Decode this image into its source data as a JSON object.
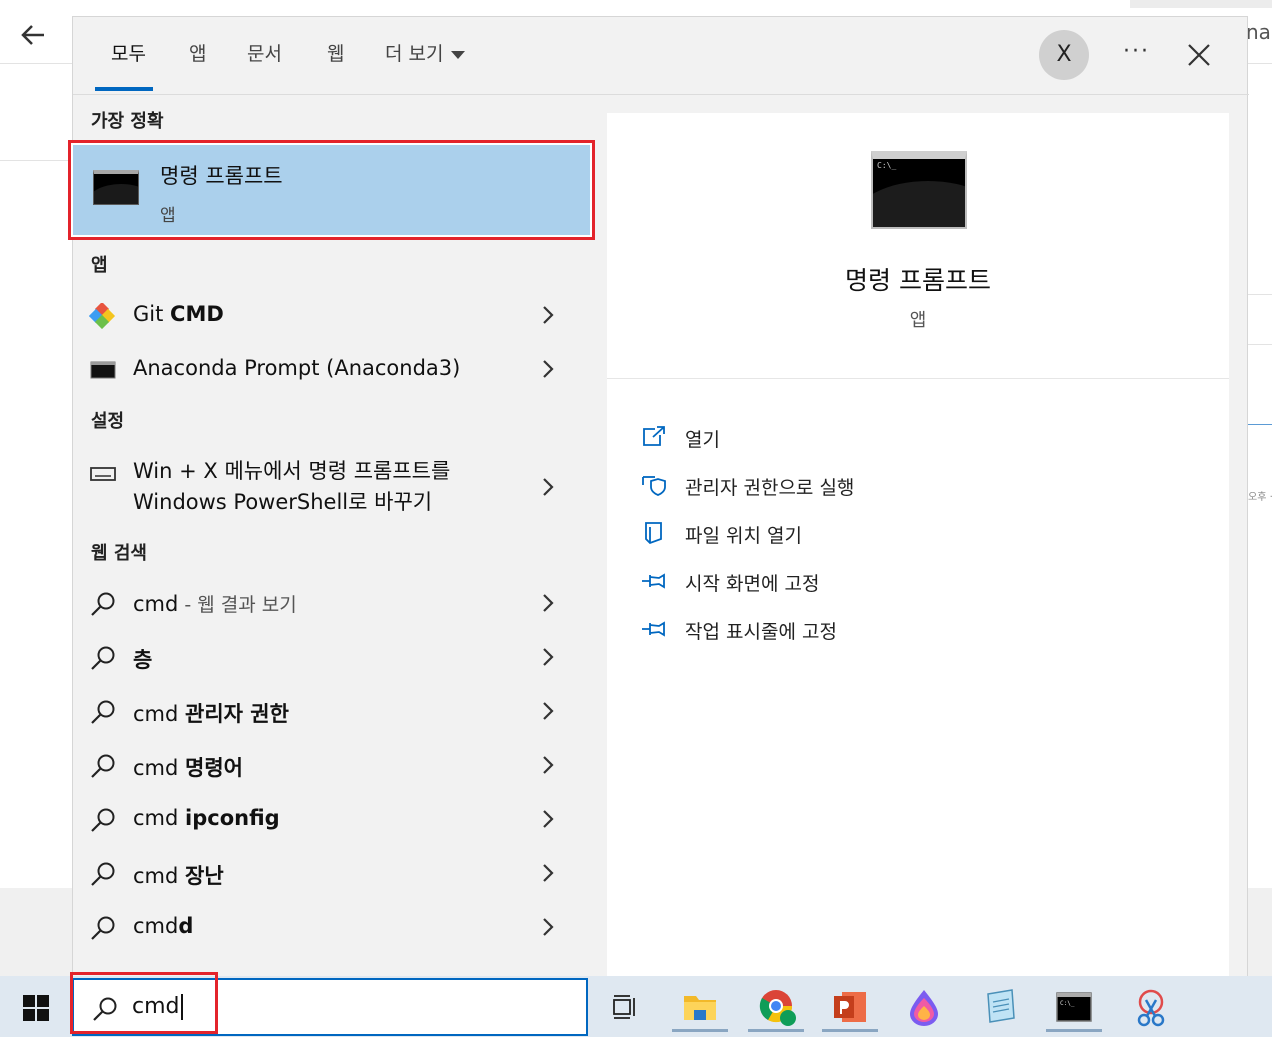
{
  "background": {
    "right_edge_text": "nag",
    "right_small_text": "오후 ·"
  },
  "tabs": [
    {
      "label": "모두"
    },
    {
      "label": "앱"
    },
    {
      "label": "문서"
    },
    {
      "label": "웹"
    },
    {
      "label": "더 보기"
    }
  ],
  "header": {
    "avatar_initial": "X",
    "more_options": "···"
  },
  "sections": {
    "best_match": "가장 정확",
    "apps": "앱",
    "settings": "설정",
    "web_search": "웹 검색"
  },
  "best_match": {
    "title": "명령 프롬프트",
    "subtitle": "앱"
  },
  "apps": [
    {
      "prefix": "Git ",
      "bold": "CMD",
      "icon": "git-icon"
    },
    {
      "prefix": "Anaconda Prompt (Anaconda3)",
      "bold": "",
      "icon": "console-icon"
    }
  ],
  "settings_item": {
    "line1": "Win + X 메뉴에서 명령 프롬프트를",
    "line2": "Windows PowerShell로 바꾸기",
    "icon": "keyboard-icon"
  },
  "web_results": [
    {
      "prefix": "cmd",
      "bold": "",
      "suffix": " - 웹 결과 보기"
    },
    {
      "prefix": "",
      "bold": "층",
      "suffix": ""
    },
    {
      "prefix": "cmd ",
      "bold": "관리자 권한",
      "suffix": ""
    },
    {
      "prefix": "cmd ",
      "bold": "명령어",
      "suffix": ""
    },
    {
      "prefix": "cmd ",
      "bold": "ipconfig",
      "suffix": ""
    },
    {
      "prefix": "cmd ",
      "bold": "장난",
      "suffix": ""
    },
    {
      "prefix": "cmd",
      "bold": "d",
      "suffix": ""
    }
  ],
  "detail": {
    "title": "명령 프롬프트",
    "subtitle": "앱",
    "actions": [
      {
        "label": "열기",
        "icon": "open-icon"
      },
      {
        "label": "관리자 권한으로 실행",
        "icon": "shield-icon"
      },
      {
        "label": "파일 위치 열기",
        "icon": "file-location-icon"
      },
      {
        "label": "시작 화면에 고정",
        "icon": "pin-icon"
      },
      {
        "label": "작업 표시줄에 고정",
        "icon": "pin-icon"
      }
    ]
  },
  "taskbar": {
    "search_value": "cmd",
    "apps": [
      "task-view-icon",
      "file-explorer-icon",
      "chrome-icon",
      "powerpoint-icon",
      "paint-icon",
      "notepad-icon",
      "command-prompt-icon",
      "snipping-tool-icon"
    ]
  },
  "colors": {
    "accent": "#0067c0",
    "highlight": "#abd0ec",
    "annotation_red": "#e3232b",
    "taskbar": "#dfe8f1"
  }
}
